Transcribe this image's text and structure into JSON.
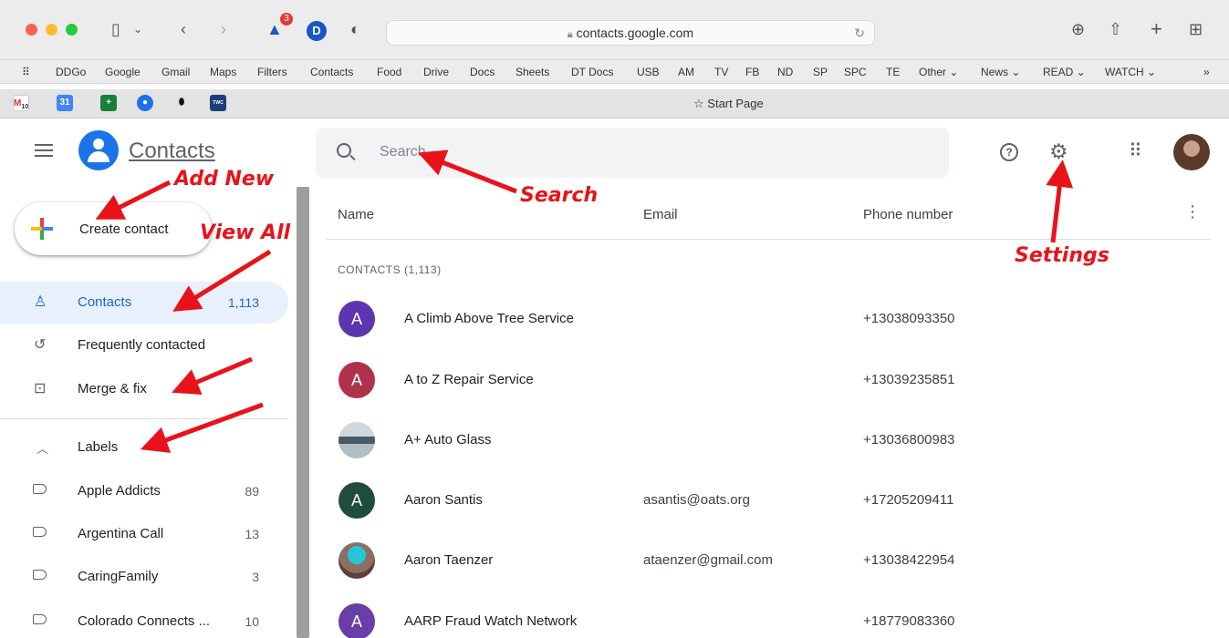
{
  "browser": {
    "url": "contacts.google.com",
    "notification_count": "3",
    "profile_letter": "D",
    "bookmarks": [
      "DDGo",
      "Google",
      "Gmail",
      "Maps",
      "Filters",
      "Contacts",
      "Food",
      "Drive",
      "Docs",
      "Sheets",
      "DT Docs",
      "USB",
      "AM",
      "TV",
      "FB",
      "ND",
      "SP",
      "SPC",
      "TE",
      "Other ⌄",
      "News ⌄",
      "READ ⌄",
      "WATCH ⌄"
    ],
    "start_page": "Start Page",
    "pinned_tab_badge": "10"
  },
  "header": {
    "app_title": "Contacts",
    "search_placeholder": "Search"
  },
  "sidebar": {
    "create_label": "Create contact",
    "nav": [
      {
        "label": "Contacts",
        "count": "1,113"
      },
      {
        "label": "Frequently contacted",
        "count": ""
      },
      {
        "label": "Merge & fix",
        "count": ""
      }
    ],
    "labels_heading": "Labels",
    "labels": [
      {
        "label": "Apple Addicts",
        "count": "89"
      },
      {
        "label": "Argentina Call",
        "count": "13"
      },
      {
        "label": "CaringFamily",
        "count": "3"
      },
      {
        "label": "Colorado Connects ...",
        "count": "10"
      }
    ]
  },
  "table": {
    "columns": [
      "Name",
      "Email",
      "Phone number"
    ],
    "section_title": "CONTACTS (1,113)",
    "rows": [
      {
        "initial": "A",
        "name": "A Climb Above Tree Service",
        "email": "",
        "phone": "+13038093350",
        "color": "#5e35b1"
      },
      {
        "initial": "A",
        "name": "A to Z Repair Service",
        "email": "",
        "phone": "+13039235851",
        "color": "#b0324a"
      },
      {
        "initial": "",
        "name": "A+ Auto Glass",
        "email": "",
        "phone": "+13036800983",
        "color": "#7a8a99"
      },
      {
        "initial": "A",
        "name": "Aaron Santis",
        "email": "asantis@oats.org",
        "phone": "+17205209411",
        "color": "#1e4d3b"
      },
      {
        "initial": "",
        "name": "Aaron Taenzer",
        "email": "ataenzer@gmail.com",
        "phone": "+13038422954",
        "color": "#6d7f8c"
      },
      {
        "initial": "A",
        "name": "AARP Fraud Watch Network",
        "email": "",
        "phone": "+18779083360",
        "color": "#6a3ea8"
      }
    ]
  },
  "annotations": {
    "add_new": "Add New",
    "view_all": "View All",
    "search": "Search",
    "settings": "Settings"
  },
  "colors": {
    "accent": "#1a73e8",
    "annotation_red": "#e8131a",
    "active_nav_bg": "#e8f0fe"
  }
}
